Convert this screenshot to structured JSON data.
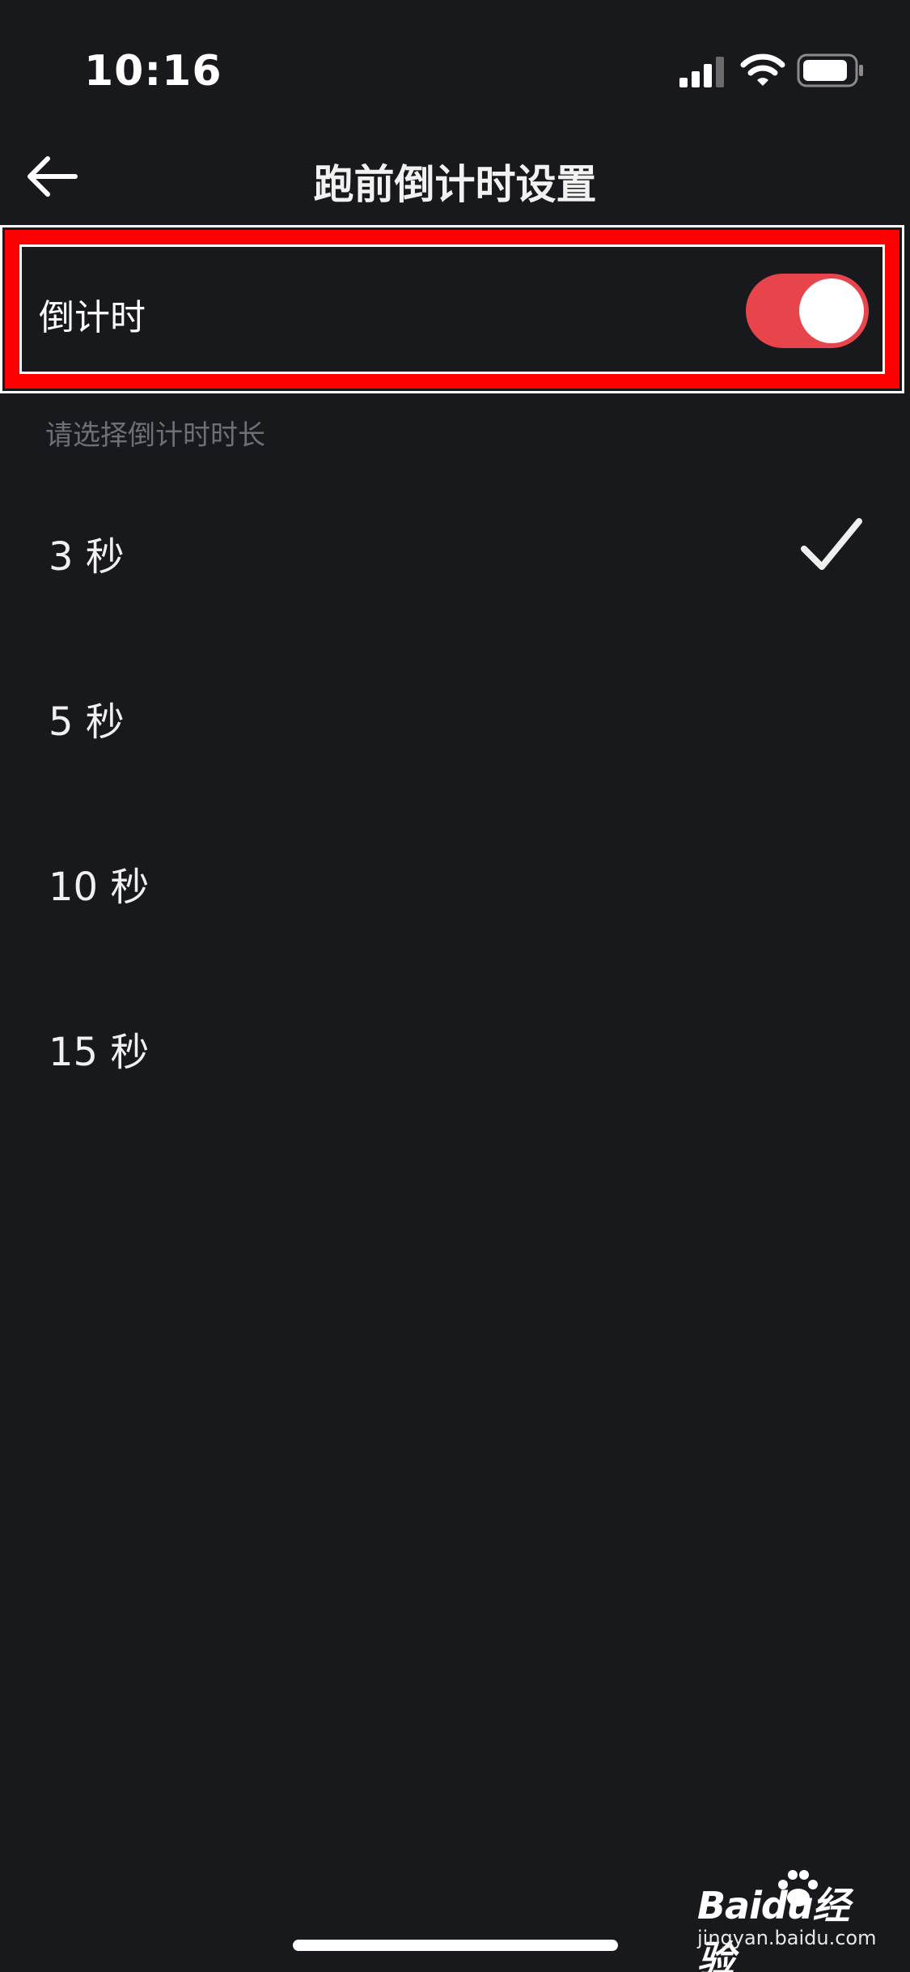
{
  "status_bar": {
    "time": "10:16",
    "signal_icon": "cellular-signal-icon",
    "wifi_icon": "wifi-icon",
    "battery_icon": "battery-icon"
  },
  "nav": {
    "back_icon": "arrow-left-icon",
    "title": "跑前倒计时设置"
  },
  "countdown_toggle": {
    "label": "倒计时",
    "enabled": true,
    "on_color": "#e8444c",
    "highlight_color": "#ff0000"
  },
  "section_hint": "请选择倒计时时长",
  "options": [
    {
      "label": "3 秒",
      "selected": true
    },
    {
      "label": "5 秒",
      "selected": false
    },
    {
      "label": "10 秒",
      "selected": false
    },
    {
      "label": "15 秒",
      "selected": false
    }
  ],
  "watermark": {
    "logo": "Baidu经验",
    "url": "jingyan.baidu.com"
  }
}
